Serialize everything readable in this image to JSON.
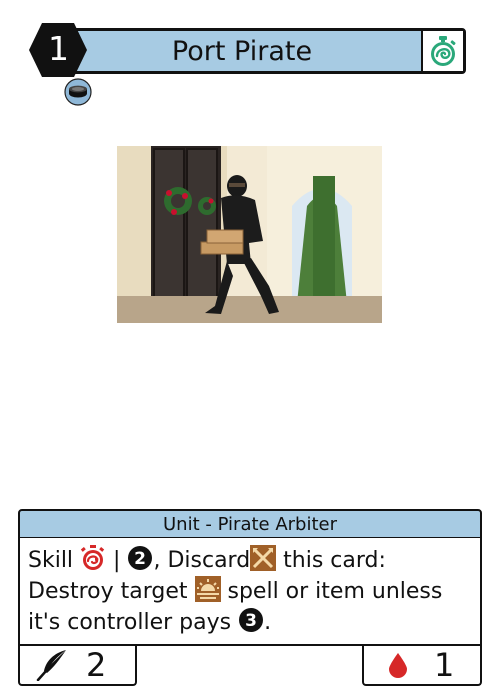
{
  "card": {
    "cost": "1",
    "name": "Port Pirate",
    "speed_icon": "stopwatch-icon",
    "faction_icon": "coin-faction-icon",
    "type_line": "Unit - Pirate Arbiter",
    "rules": {
      "line1_a": "Skill",
      "line1_b": "|",
      "line1_c": ", Discard",
      "line1_d": "this card:",
      "line2_a": "Destroy target",
      "line2_b": "spell or item unless",
      "line3_a": "it's controller pays",
      "line3_b": "."
    },
    "power": "2",
    "health": "1",
    "colors": {
      "header": "#a7cbe3",
      "speed": "#2aa87a",
      "clock_icon": "#d62828",
      "blood": "#d62828",
      "discard_icon": "#a06028"
    }
  }
}
